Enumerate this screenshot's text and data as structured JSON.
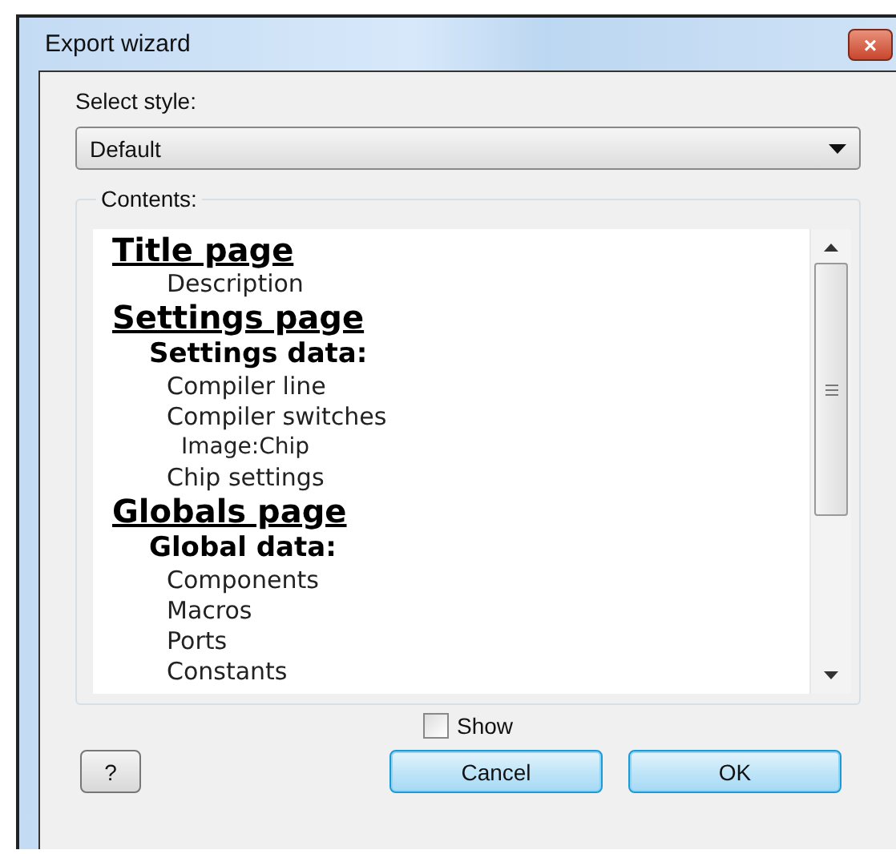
{
  "window": {
    "title": "Export wizard",
    "close": "×"
  },
  "style_select": {
    "label": "Select style:",
    "value": "Default"
  },
  "contents": {
    "label": "Contents:",
    "sections": [
      {
        "title": "Title page",
        "children": [
          {
            "kind": "item",
            "label": "Description"
          }
        ]
      },
      {
        "title": "Settings page",
        "children": [
          {
            "kind": "group",
            "label": "Settings data:"
          },
          {
            "kind": "item",
            "label": "Compiler line"
          },
          {
            "kind": "item",
            "label": "Compiler switches"
          },
          {
            "kind": "subitem",
            "label": "Image:Chip"
          },
          {
            "kind": "item",
            "label": "Chip settings"
          }
        ]
      },
      {
        "title": "Globals page",
        "children": [
          {
            "kind": "group",
            "label": "Global data:"
          },
          {
            "kind": "item",
            "label": "Components"
          },
          {
            "kind": "item",
            "label": "Macros"
          },
          {
            "kind": "item",
            "label": "Ports"
          },
          {
            "kind": "item",
            "label": "Constants"
          }
        ]
      }
    ]
  },
  "show": {
    "label": "Show",
    "checked": false
  },
  "buttons": [
    {
      "kind": "help",
      "label": "?"
    },
    {
      "kind": "action",
      "label": "Cancel"
    },
    {
      "kind": "action",
      "label": "OK"
    }
  ]
}
